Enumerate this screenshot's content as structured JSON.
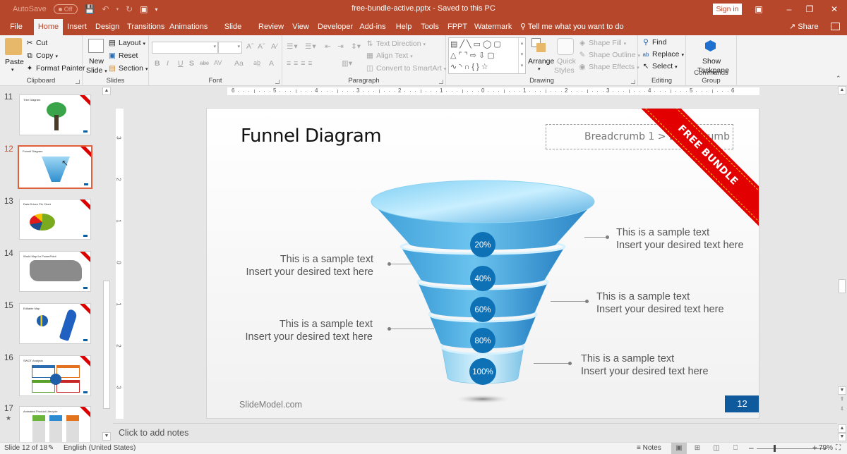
{
  "titlebar": {
    "autosave_label": "AutoSave",
    "autosave_state": "Off",
    "document_title": "free-bundle-active.pptx  -  Saved to this PC",
    "sign_in": "Sign in"
  },
  "tabs": [
    {
      "label": "File"
    },
    {
      "label": "Home"
    },
    {
      "label": "Insert"
    },
    {
      "label": "Design"
    },
    {
      "label": "Transitions"
    },
    {
      "label": "Animations"
    },
    {
      "label": "Slide Show"
    },
    {
      "label": "Review"
    },
    {
      "label": "View"
    },
    {
      "label": "Developer"
    },
    {
      "label": "Add-ins"
    },
    {
      "label": "Help"
    },
    {
      "label": "Tools"
    },
    {
      "label": "FPPT"
    },
    {
      "label": "Watermark"
    }
  ],
  "active_tab": "Home",
  "tell_me": "Tell me what you want to do",
  "share": "Share",
  "ribbon": {
    "clipboard": {
      "label": "Clipboard",
      "paste": "Paste",
      "cut": "Cut",
      "copy": "Copy",
      "format_painter": "Format Painter"
    },
    "slides": {
      "label": "Slides",
      "new_slide_1": "New",
      "new_slide_2": "Slide",
      "layout": "Layout",
      "reset": "Reset",
      "section": "Section"
    },
    "font": {
      "label": "Font",
      "font_name": "",
      "font_size": "",
      "bold": "B",
      "italic": "I",
      "underline": "U",
      "shadow": "S",
      "strike": "abc",
      "spacing": "AV",
      "case": "Aa",
      "color": "A"
    },
    "paragraph": {
      "label": "Paragraph",
      "text_direction": "Text Direction",
      "align_text": "Align Text",
      "smartart": "Convert to SmartArt"
    },
    "drawing": {
      "label": "Drawing",
      "arrange": "Arrange",
      "quick_styles_1": "Quick",
      "quick_styles_2": "Styles",
      "shape_fill": "Shape Fill",
      "shape_outline": "Shape Outline",
      "shape_effects": "Shape Effects"
    },
    "editing": {
      "label": "Editing",
      "find": "Find",
      "replace": "Replace",
      "select": "Select"
    },
    "commands": {
      "label": "Commands Group",
      "show_taskpane_1": "Show",
      "show_taskpane_2": "Taskpane"
    }
  },
  "thumbnails": [
    {
      "num": "11",
      "title": "Tree Diagram"
    },
    {
      "num": "12",
      "title": "Funnel Diagram",
      "active": true
    },
    {
      "num": "13",
      "title": "Data Driven Pie Chart"
    },
    {
      "num": "14",
      "title": "World Map for PowerPoint"
    },
    {
      "num": "15",
      "title": "Editable Map"
    },
    {
      "num": "16",
      "title": "SWOT Analysis"
    },
    {
      "num": "17",
      "title": "Animated Product Lifecycle",
      "animated": true
    }
  ],
  "ruler": {
    "h_ticks": [
      "6",
      "5",
      "4",
      "3",
      "2",
      "1",
      "0",
      "1",
      "2",
      "3",
      "4",
      "5",
      "6"
    ],
    "v_ticks": [
      "3",
      "2",
      "1",
      "0",
      "1",
      "2",
      "3"
    ]
  },
  "slide": {
    "title": "Funnel Diagram",
    "breadcrumb": "Breadcrumb 1 > Breadcrumb 2",
    "banner": "FREE BUNDLE",
    "footer": "SlideModel.com",
    "page_number": "12",
    "funnel_levels": [
      {
        "label": "20%",
        "value": 20
      },
      {
        "label": "40%",
        "value": 40
      },
      {
        "label": "60%",
        "value": 60
      },
      {
        "label": "80%",
        "value": 80
      },
      {
        "label": "100%",
        "value": 100
      }
    ],
    "callouts": [
      {
        "line1": "This is a sample text",
        "line2": "Insert your desired text here"
      },
      {
        "line1": "This is a sample text",
        "line2": "Insert your desired text here"
      },
      {
        "line1": "This is a sample text",
        "line2": "Insert your desired text here"
      },
      {
        "line1": "This is a sample text",
        "line2": "Insert your desired text here"
      },
      {
        "line1": "This is a sample text",
        "line2": "Insert your desired text here"
      }
    ]
  },
  "notes_placeholder": "Click to add notes",
  "status": {
    "slide_info": "Slide 12 of 18",
    "language": "English (United States)",
    "notes": "Notes",
    "zoom": "79%"
  }
}
